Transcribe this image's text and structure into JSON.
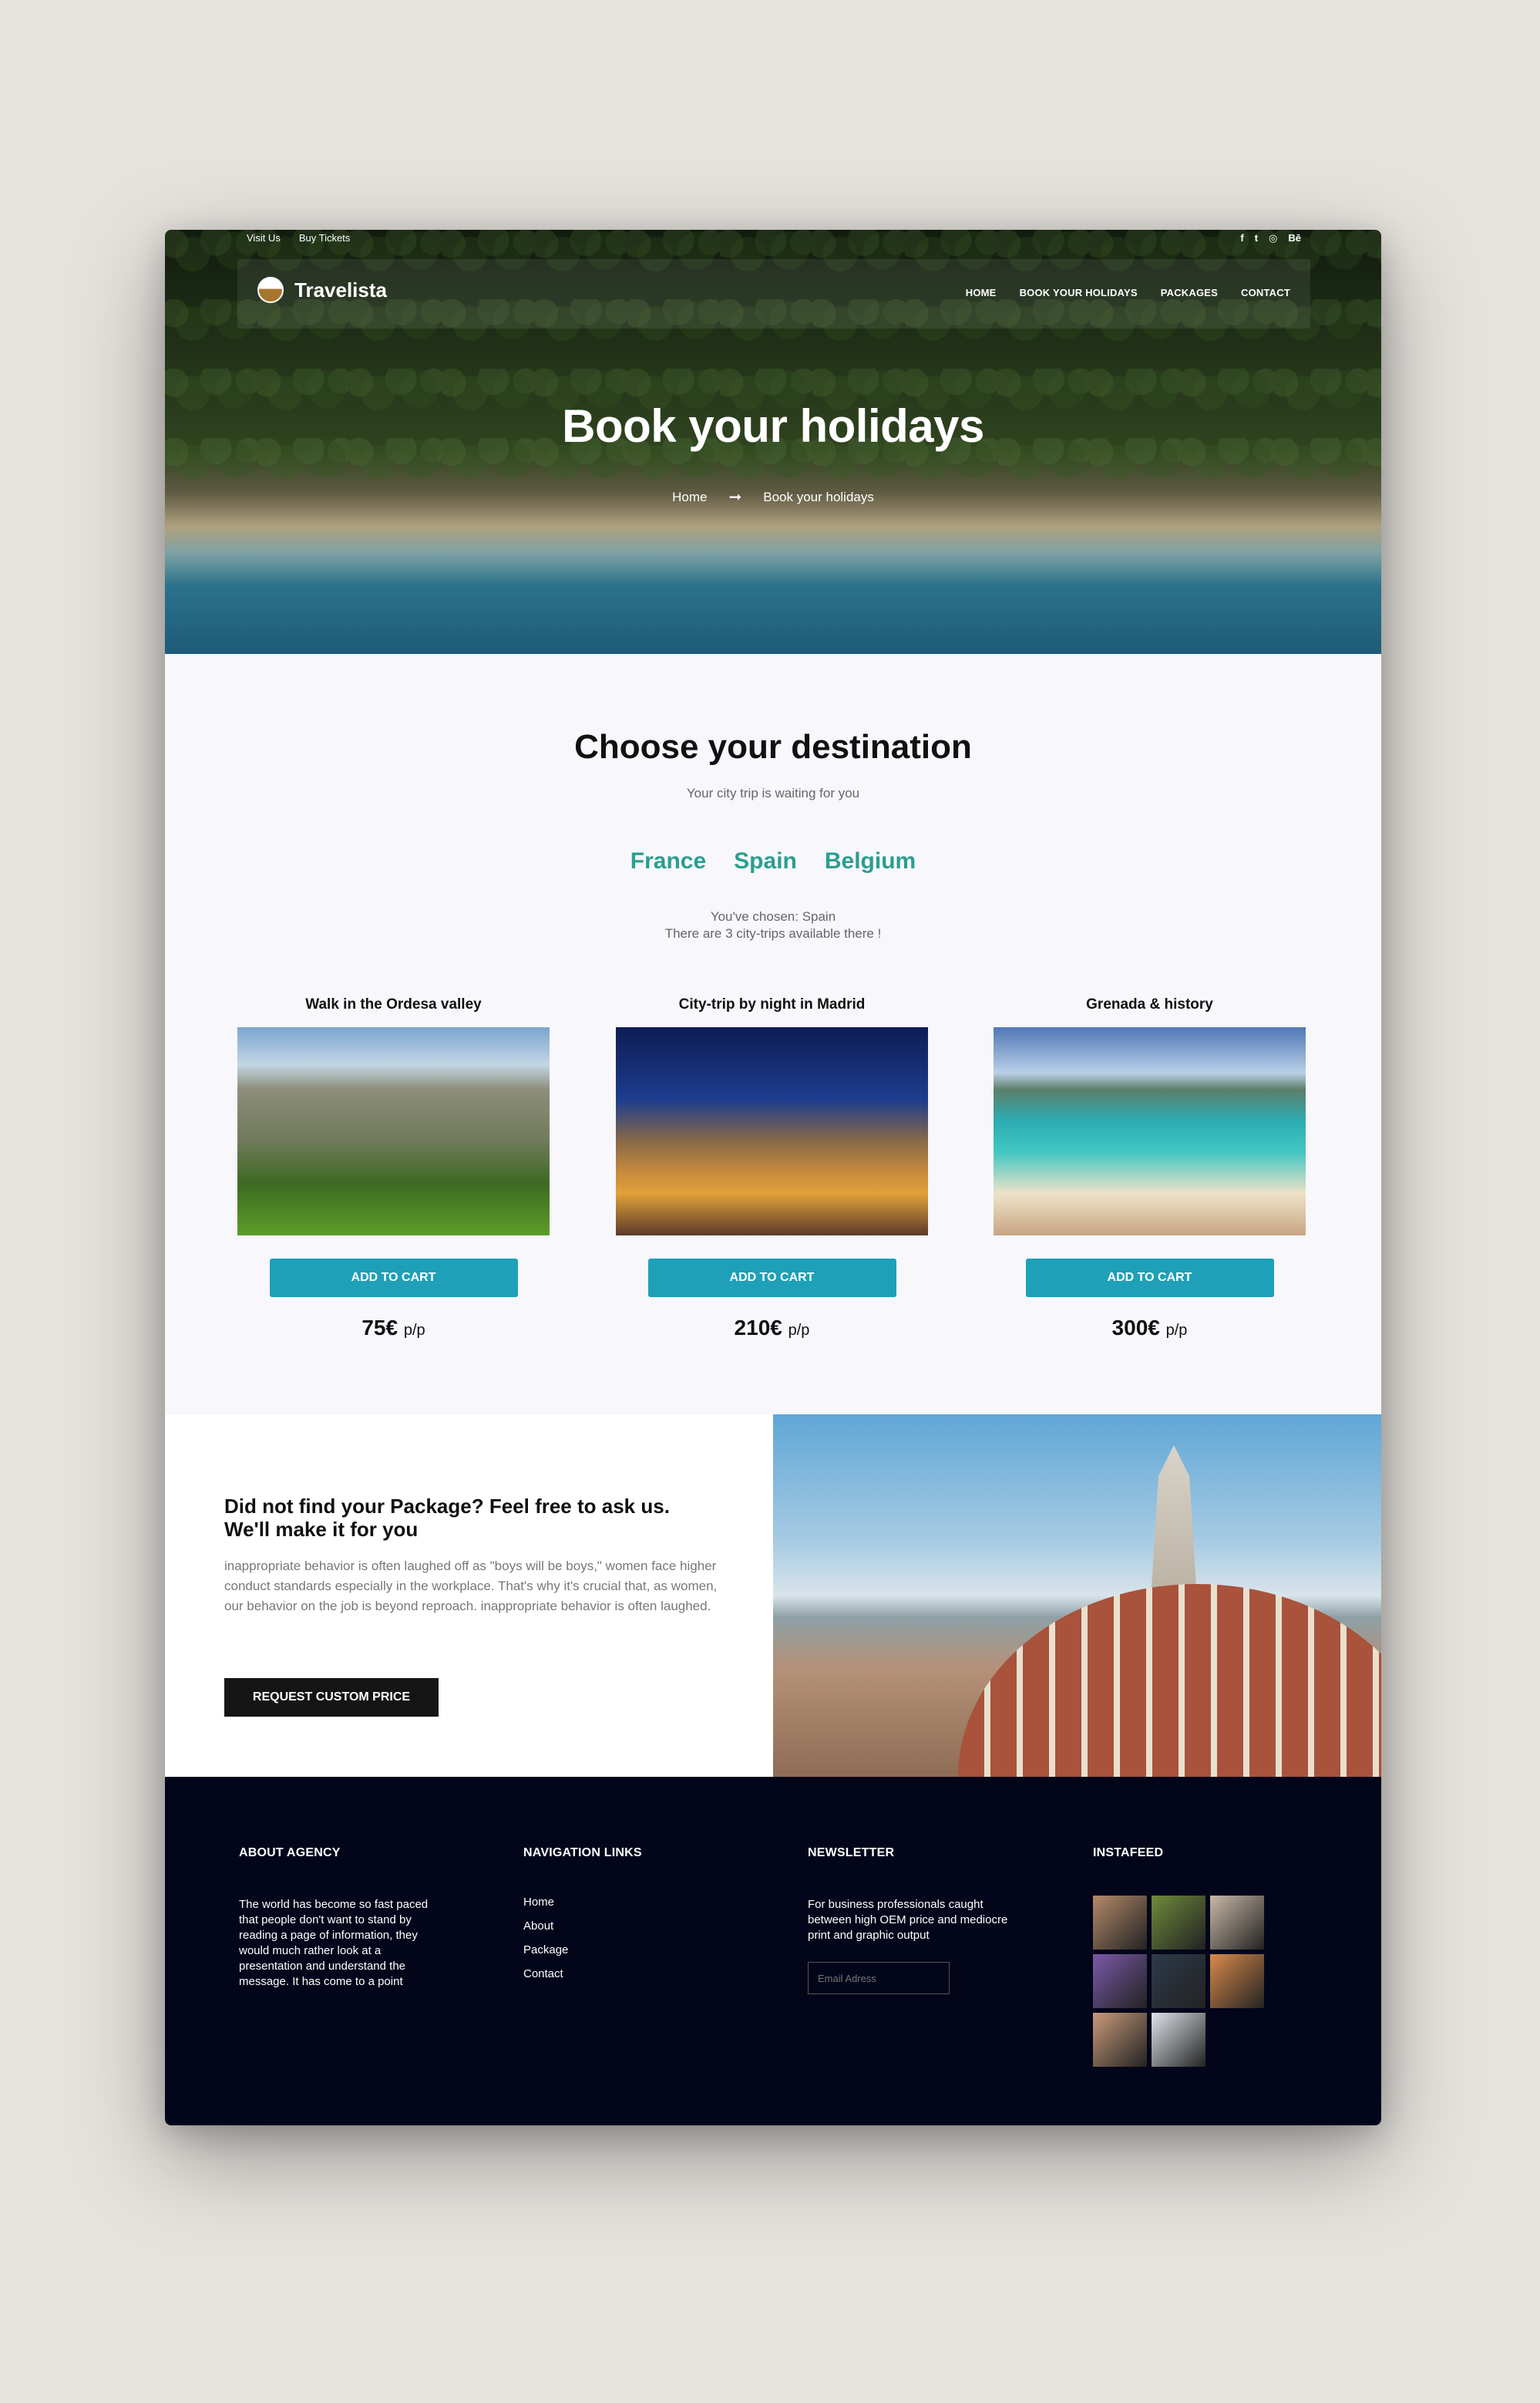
{
  "topbar": {
    "links": [
      "Visit Us",
      "Buy Tickets"
    ],
    "social": [
      {
        "icon": "facebook-icon",
        "glyph": "f"
      },
      {
        "icon": "twitter-icon",
        "glyph": "t"
      },
      {
        "icon": "dribbble-icon",
        "glyph": "◎"
      },
      {
        "icon": "behance-icon",
        "glyph": "Bē"
      }
    ]
  },
  "brand": {
    "name": "Travelista"
  },
  "nav": {
    "items": [
      "HOME",
      "BOOK YOUR HOLIDAYS",
      "PACKAGES",
      "CONTACT"
    ]
  },
  "hero": {
    "title": "Book your holidays",
    "breadcrumb": {
      "home": "Home",
      "separator": "➞",
      "current": "Book your holidays"
    }
  },
  "destinations": {
    "title": "Choose your destination",
    "subtitle": "Your city trip is waiting for you",
    "countries": [
      "France",
      "Spain",
      "Belgium"
    ],
    "chosen_line1": "You've chosen: Spain",
    "chosen_line2": "There are 3 city-trips available there !",
    "cards": [
      {
        "title": "Walk in the Ordesa valley",
        "button": "ADD TO CART",
        "price": "75€",
        "unit": "p/p"
      },
      {
        "title": "City-trip by night in Madrid",
        "button": "ADD TO CART",
        "price": "210€",
        "unit": "p/p"
      },
      {
        "title": "Grenada & history",
        "button": "ADD TO CART",
        "price": "300€",
        "unit": "p/p"
      }
    ]
  },
  "custom": {
    "heading": "Did not find your Package? Feel free to ask us. We'll make it for you",
    "body": "inappropriate behavior is often laughed off as \"boys will be boys,\" women face higher conduct standards especially in the workplace. That's why it's crucial that, as women, our behavior on the job is beyond reproach. inappropriate behavior is often laughed.",
    "button": "REQUEST CUSTOM PRICE"
  },
  "footer": {
    "about": {
      "heading": "ABOUT AGENCY",
      "text": "The world has become so fast paced that people don't want to stand by reading a page of information, they would much rather look at a presentation and understand the message. It has come to a point"
    },
    "navigation": {
      "heading": "NAVIGATION LINKS",
      "links": [
        "Home",
        "About",
        "Package",
        "Contact"
      ]
    },
    "newsletter": {
      "heading": "NEWSLETTER",
      "text": "For business professionals caught between high OEM price and mediocre print and graphic output",
      "placeholder": "Email Adress"
    },
    "instafeed": {
      "heading": "INSTAFEED",
      "thumb_colors": [
        "#b48a6a",
        "#6f8a3a",
        "#c8b8a6",
        "#7a5aa8",
        "#2e3a4a",
        "#d98a4a",
        "#c99a7a",
        "#dfe4ea"
      ]
    }
  },
  "colors": {
    "accent": "#1ea0b8",
    "country": "#2b9e8f",
    "footer_bg": "#03061a",
    "dark_button": "#151515"
  }
}
